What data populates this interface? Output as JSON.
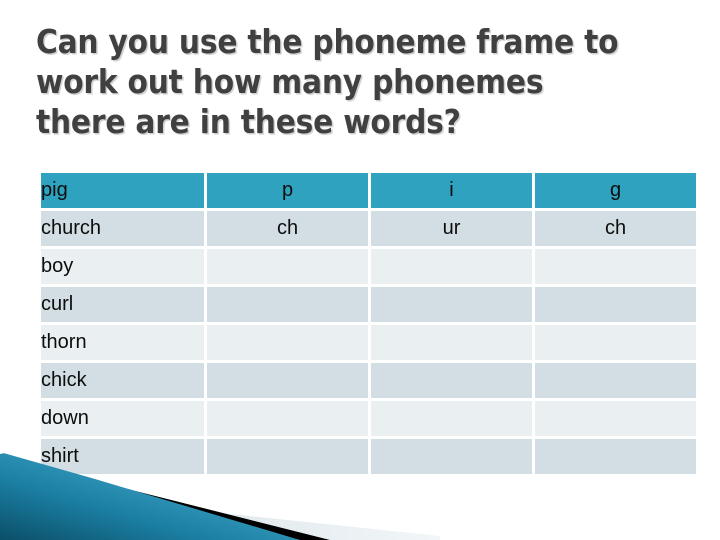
{
  "slide": {
    "title": "Can you use the phoneme frame to\nwork out how many phonemes\nthere are in these words?",
    "background_color": "#ffffff",
    "title_color": "#404040"
  },
  "table": {
    "header_fill": "#2fa2c0",
    "header_text_color": "#ffffff",
    "row_dark_fill": "#d2dee4",
    "row_light_fill": "#eaeff1",
    "rows": [
      {
        "word": "pig",
        "p1": "p",
        "p2": "i",
        "p3": "g",
        "style": "header"
      },
      {
        "word": "church",
        "p1": "ch",
        "p2": "ur",
        "p3": "ch",
        "style": "dark"
      },
      {
        "word": "boy",
        "p1": "",
        "p2": "",
        "p3": "",
        "style": "light"
      },
      {
        "word": "curl",
        "p1": "",
        "p2": "",
        "p3": "",
        "style": "dark"
      },
      {
        "word": "thorn",
        "p1": "",
        "p2": "",
        "p3": "",
        "style": "light"
      },
      {
        "word": "chick",
        "p1": "",
        "p2": "",
        "p3": "",
        "style": "dark"
      },
      {
        "word": "down",
        "p1": "",
        "p2": "",
        "p3": "",
        "style": "light"
      },
      {
        "word": "shirt",
        "p1": "",
        "p2": "",
        "p3": "",
        "style": "dark"
      }
    ]
  },
  "banner": {
    "teal_dark": "#0d5c78",
    "teal_light": "#55b2d2",
    "black_stripe": "#000000",
    "pale_wedge": "#dbe5ea"
  }
}
